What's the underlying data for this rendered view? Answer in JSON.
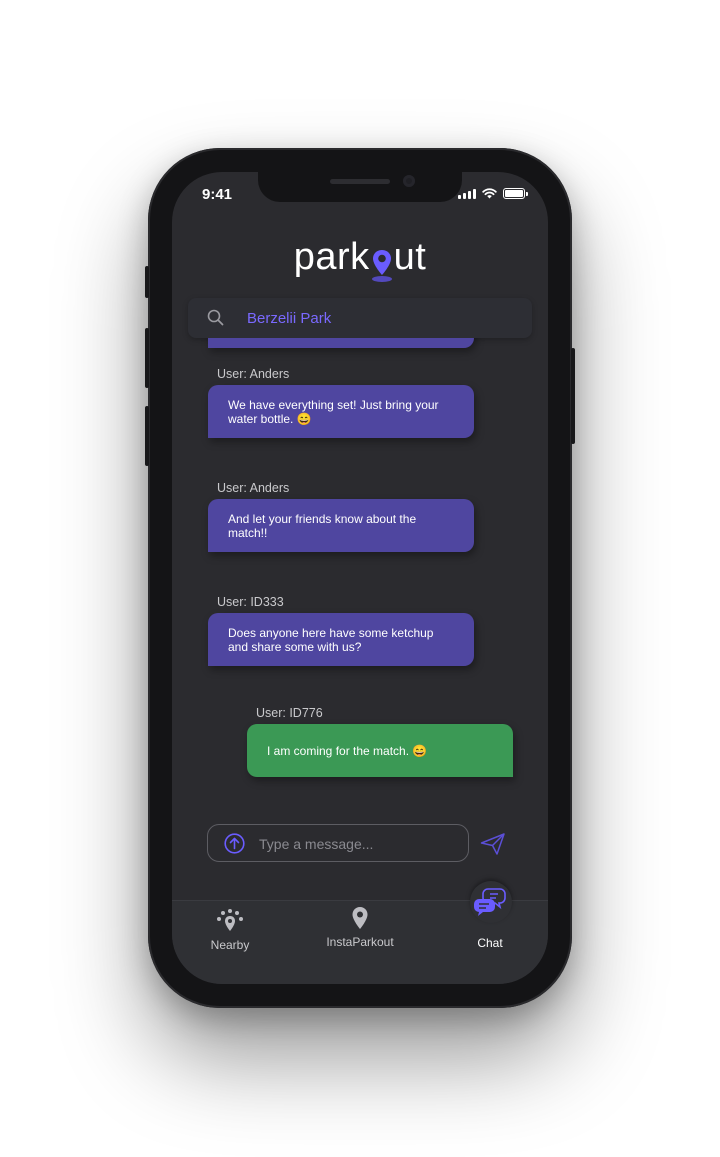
{
  "status_bar": {
    "time": "9:41"
  },
  "app": {
    "logo_left": "park",
    "logo_right": "ut"
  },
  "search": {
    "value": "Berzelii Park"
  },
  "messages": [
    {
      "user": "User: Anders",
      "text": "We have everything set! Just bring your water bottle.  😄",
      "color": "#4f46a0"
    },
    {
      "user": "User: Anders",
      "text": "And let your friends know about the match!!",
      "color": "#4f46a0"
    },
    {
      "user": "User: ID333",
      "text": "Does anyone here have some ketchup and share some with us?",
      "color": "#4f46a0"
    },
    {
      "user": "User: ID776",
      "text": "I am coming for the match.  😄",
      "color": "#3b9955"
    }
  ],
  "composer": {
    "placeholder": "Type a message..."
  },
  "tabs": [
    {
      "label": "Nearby",
      "icon": "nearby-icon"
    },
    {
      "label": "InstaParkout",
      "icon": "location-pin-icon"
    },
    {
      "label": "Chat",
      "icon": "chat-bubbles-icon",
      "active": true
    }
  ],
  "colors": {
    "accent": "#7a69ff",
    "purple_bubble": "#4f46a0",
    "green_bubble": "#3b9955",
    "background": "#2b2b2f"
  }
}
